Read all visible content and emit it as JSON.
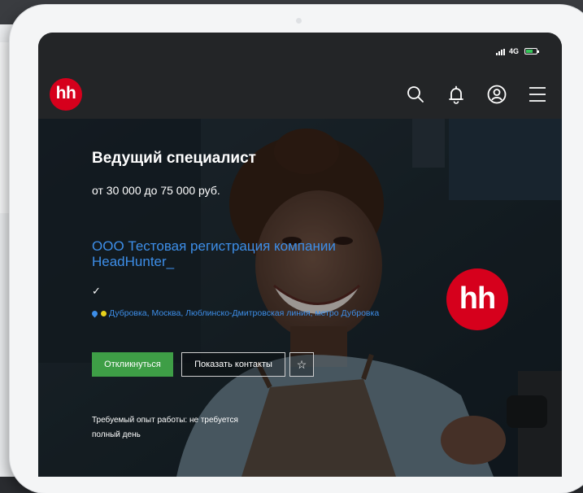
{
  "status_bar": {
    "network": "4G",
    "battery_level": 0.7
  },
  "header": {
    "logo": "hh",
    "icons": [
      "search-icon",
      "bell-icon",
      "user-icon",
      "menu-icon"
    ]
  },
  "vacancy": {
    "title": "Ведущий специалист",
    "salary": "от 30 000 до 75 000 руб.",
    "company": "ООО Тестовая регистрация компании HeadHunter_",
    "verified_mark": "✓",
    "address": "Дубровка, Москва, Люблинско-Дмитровская линия, метро Дубровка",
    "respond_label": "Откликнуться",
    "contacts_label": "Показать контакты",
    "favorite_icon": "☆",
    "experience": "Требуемый опыт работы: не требуется",
    "schedule": "полный день",
    "company_logo": "hh"
  },
  "colors": {
    "brand_red": "#d6001c",
    "link_blue": "#3d8ee8",
    "respond_green": "#3e9e46",
    "metro_yellow": "#e8d21c",
    "header_bg": "#232527"
  }
}
